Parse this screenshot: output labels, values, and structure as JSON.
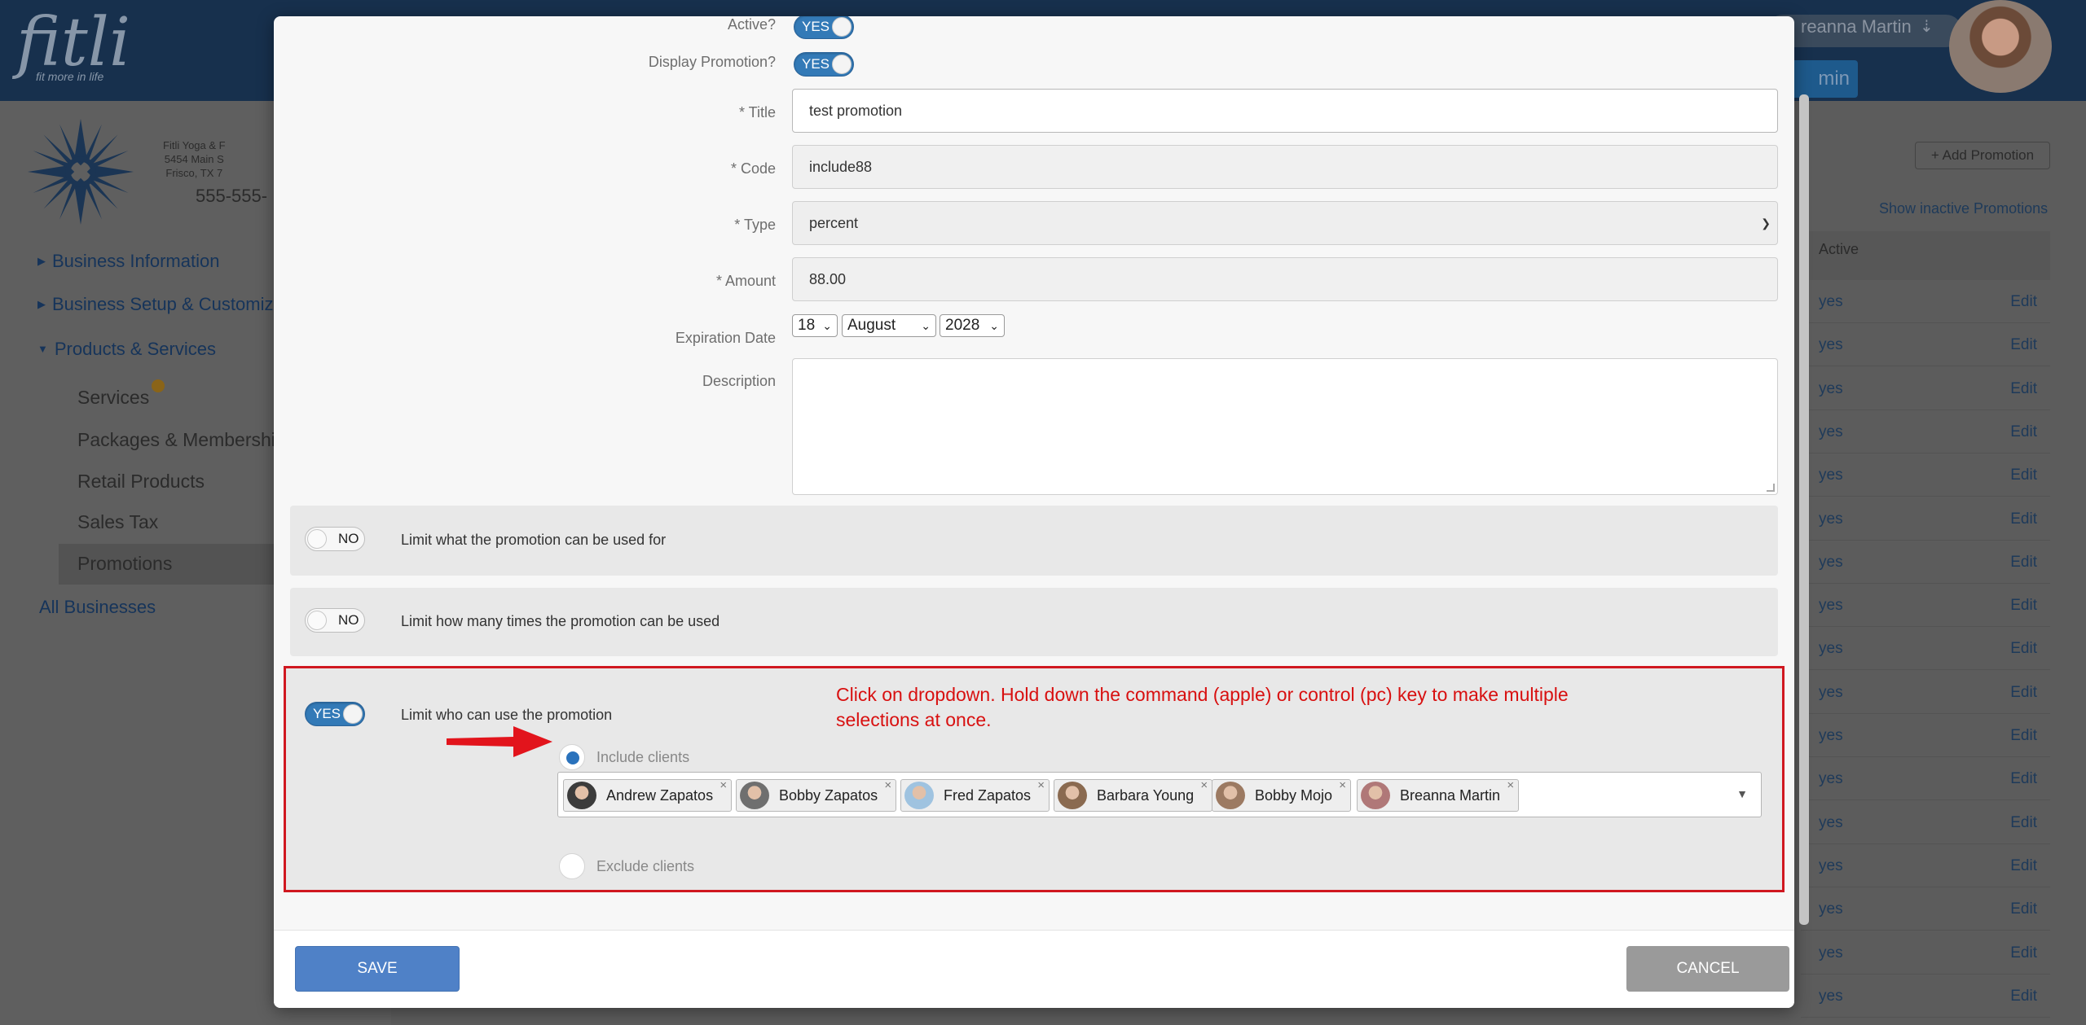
{
  "app": {
    "logo": "fitli",
    "tagline": "fit more in life",
    "user_name": "reanna Martin",
    "admin_label": "min"
  },
  "business": {
    "name": "Fitli Yoga & F",
    "address1": "5454 Main S",
    "address2": "Frisco, TX 7",
    "phone": "555-555-"
  },
  "sidebar": {
    "business_information": "Business Information",
    "business_setup": "Business Setup & Customiza",
    "products_services": "Products & Services",
    "items": [
      "Services",
      "Packages & Memberships",
      "Retail Products",
      "Sales Tax",
      "Promotions"
    ],
    "all_businesses": "All Businesses"
  },
  "background": {
    "add_promotion": "+ Add Promotion",
    "show_inactive": "Show inactive Promotions",
    "active_col": "Active",
    "row_yes": "yes",
    "row_edit": "Edit"
  },
  "form": {
    "active_label": "Active?",
    "active_value": "YES",
    "display_label": "Display Promotion?",
    "display_value": "YES",
    "title_label": "* Title",
    "title_value": "test promotion",
    "code_label": "* Code",
    "code_value": "include88",
    "type_label": "* Type",
    "type_value": "percent",
    "amount_label": "* Amount",
    "amount_value": "88.00",
    "expiration_label": "Expiration Date",
    "exp_day": "18",
    "exp_month": "August",
    "exp_year": "2028",
    "description_label": "Description"
  },
  "sections": {
    "limit_usage_toggle": "NO",
    "limit_usage_text": "Limit what the promotion can be used for",
    "limit_times_toggle": "NO",
    "limit_times_text": "Limit how many times the promotion can be used",
    "limit_who_toggle": "YES",
    "limit_who_text": "Limit who can use the promotion",
    "include_clients": "Include clients",
    "exclude_clients": "Exclude clients",
    "instruction": "Click on dropdown.  Hold down the command (apple) or control (pc) key to make multiple selections at once."
  },
  "clients": [
    {
      "name": "Andrew Zapatos",
      "color": "#3b3b3b"
    },
    {
      "name": "Bobby Zapatos",
      "color": "#6f6f6f"
    },
    {
      "name": "Fred Zapatos",
      "color": "#9fc3e0"
    },
    {
      "name": "Barbara Young",
      "color": "#8a6a50"
    },
    {
      "name": "Bobby Mojo",
      "color": "#9c7a62"
    },
    {
      "name": "Breanna Martin",
      "color": "#b07878"
    }
  ],
  "footer": {
    "save": "SAVE",
    "cancel": "CANCEL"
  },
  "colors": {
    "accent": "#337ab7",
    "save_button": "#4f81c7",
    "annotation_red": "#d01820"
  }
}
